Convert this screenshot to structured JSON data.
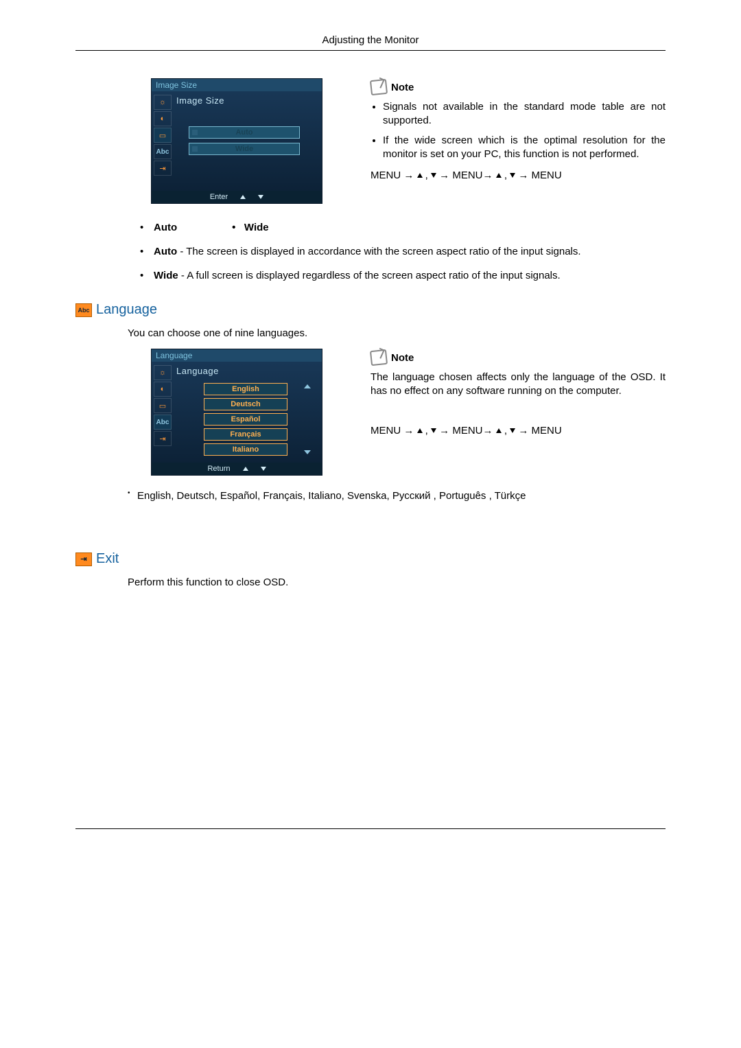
{
  "header": {
    "title": "Adjusting the Monitor"
  },
  "image_size": {
    "osd": {
      "title": "Image Size",
      "subtitle": "Image Size",
      "options": [
        "Auto",
        "Wide"
      ],
      "footer_label": "Enter"
    },
    "note_label": "Note",
    "note_items": [
      "Signals not available in the standard mode table are not supported.",
      "If the wide screen which is the optimal resolution for the monitor is set on your PC, this function is not performed."
    ],
    "nav": "MENU → ▲ , ▼ → MENU→ ▲ , ▼ → MENU",
    "inline_options": [
      "Auto",
      "Wide"
    ],
    "desc_auto_label": "Auto",
    "desc_auto_text": " - The screen is displayed in accordance with the screen aspect ratio of the input signals.",
    "desc_wide_label": "Wide",
    "desc_wide_text": " - A full screen is displayed regardless of the screen aspect ratio of the input signals."
  },
  "language": {
    "heading": "Language",
    "intro": "You can choose one of nine languages.",
    "osd": {
      "title": "Language",
      "subtitle": "Language",
      "options": [
        "English",
        "Deutsch",
        "Español",
        "Français",
        "Italiano"
      ],
      "footer_label": "Return"
    },
    "note_label": "Note",
    "note_text": "The language chosen affects only the language of the OSD. It has no effect on any software running on the computer.",
    "nav": "MENU → ▲ , ▼ → MENU→ ▲ , ▼ → MENU",
    "all_languages": "English, Deutsch, Español, Français,  Italiano, Svenska, Русский , Português , Türkçe"
  },
  "exit": {
    "heading": "Exit",
    "text": "Perform this function to close OSD."
  }
}
